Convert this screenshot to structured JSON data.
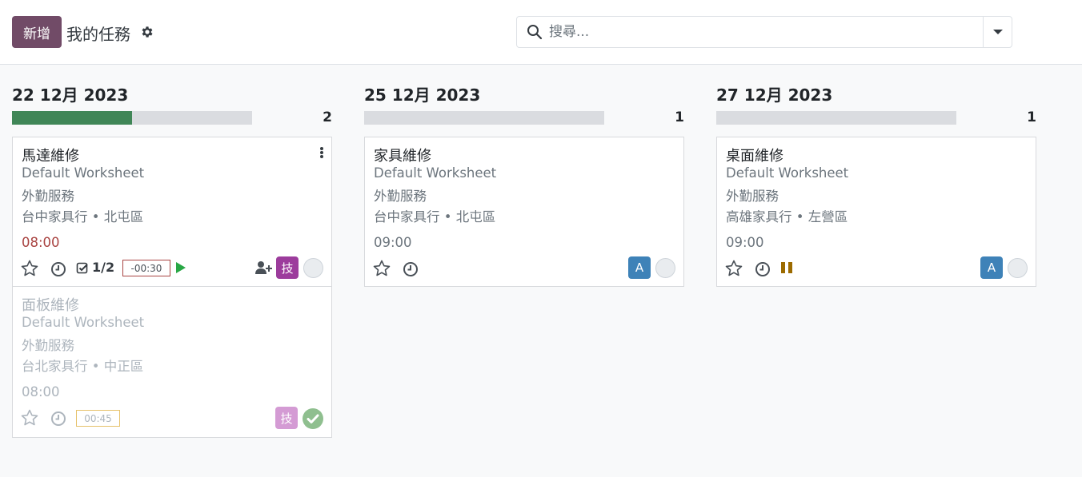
{
  "header": {
    "new_button": "新增",
    "breadcrumb": "我的任務",
    "search_placeholder": "搜尋..."
  },
  "columns": [
    {
      "title": "22 12月 2023",
      "count": "2",
      "progress": 0.5,
      "cards": [
        {
          "title": "馬達維修",
          "worksheet": "Default Worksheet",
          "project": "外勤服務",
          "customer": "台中家具行 • 北屯區",
          "time": "08:00",
          "subtasks": "1/2",
          "timer": "-00:30",
          "avatar": "技",
          "avatar_color": "#9c3c9c"
        },
        {
          "title": "面板維修",
          "worksheet": "Default Worksheet",
          "project": "外勤服務",
          "customer": "台北家具行 • 中正區",
          "time": "08:00",
          "timer": "00:45",
          "avatar": "技",
          "avatar_color": "#d49bd4"
        }
      ]
    },
    {
      "title": "25 12月 2023",
      "count": "1",
      "progress": 0,
      "cards": [
        {
          "title": "家具維修",
          "worksheet": "Default Worksheet",
          "project": "外勤服務",
          "customer": "台中家具行 • 北屯區",
          "time": "09:00",
          "avatar": "A",
          "avatar_color": "#3e82b8"
        }
      ]
    },
    {
      "title": "27 12月 2023",
      "count": "1",
      "progress": 0,
      "cards": [
        {
          "title": "桌面維修",
          "worksheet": "Default Worksheet",
          "project": "外勤服務",
          "customer": "高雄家具行 • 左營區",
          "time": "09:00",
          "avatar": "A",
          "avatar_color": "#3e82b8"
        }
      ]
    }
  ]
}
